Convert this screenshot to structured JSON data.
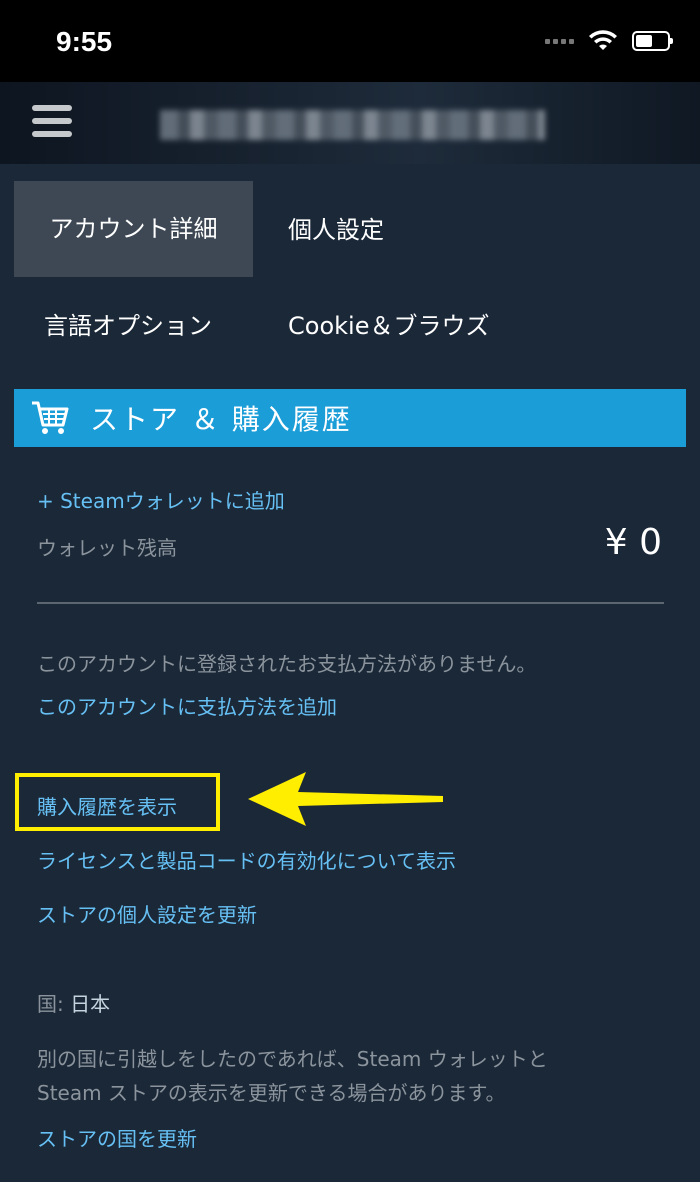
{
  "status_bar": {
    "time": "9:55"
  },
  "tabs": {
    "account": "アカウント詳細",
    "personal": "個人設定",
    "language": "言語オプション",
    "cookie": "Cookie＆ブラウズ"
  },
  "section": {
    "title": "ストア ＆ 購入履歴"
  },
  "wallet": {
    "add_link": "+ Steamウォレットに追加",
    "balance_label": "ウォレット残高",
    "balance_value": "¥ 0"
  },
  "payment": {
    "none_text": "このアカウントに登録されたお支払方法がありません。",
    "add_link": "このアカウントに支払方法を追加"
  },
  "links": {
    "purchase_history": "購入履歴を表示",
    "license": "ライセンスと製品コードの有効化について表示",
    "store_preferences": "ストアの個人設定を更新"
  },
  "country": {
    "label": "国:",
    "value": "日本",
    "move_line1": "別の国に引越しをしたのであれば、Steam ウォレットと",
    "move_line2": "Steam ストアの表示を更新できる場合があります。",
    "update_link": "ストアの国を更新"
  },
  "colors": {
    "background": "#1b2838",
    "accent": "#1b9dd8",
    "link": "#66c0f4",
    "highlight": "#ffee00"
  },
  "icons": [
    "wifi-icon",
    "battery-icon",
    "hamburger-menu-icon",
    "shopping-cart-icon",
    "arrow-icon"
  ]
}
